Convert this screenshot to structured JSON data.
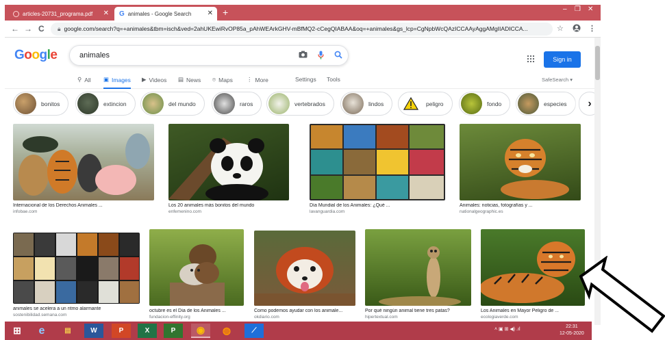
{
  "browser": {
    "tabs": [
      {
        "label": "articles-20731_programa.pdf"
      },
      {
        "label": "animales - Google Search"
      }
    ],
    "new_tab": "+",
    "tab_close": "✕",
    "window_controls": {
      "minimize": "–",
      "restore": "❐",
      "close": "✕"
    },
    "nav": {
      "back": "←",
      "forward": "→",
      "reload": "C"
    },
    "url": "google.com/search?q=+animales&tbm=isch&ved=2ahUKEwiRvOP85a_pAhWEArkGHV-mBfMQ2-cCegQIABAA&oq=+animales&gs_lcp=CgNpbWcQAzICCAAyAggAMgIIADICCA...",
    "bookmark_icon": "☆",
    "menu_icon": "⋮"
  },
  "google": {
    "logo": [
      "G",
      "o",
      "o",
      "g",
      "l",
      "e"
    ],
    "query": "animales",
    "sign_in": "Sign in",
    "tabs": [
      {
        "label": "All",
        "icon": "⚲"
      },
      {
        "label": "Images",
        "icon": "▣"
      },
      {
        "label": "Videos",
        "icon": "▶"
      },
      {
        "label": "News",
        "icon": "▤"
      },
      {
        "label": "Maps",
        "icon": "⌾"
      },
      {
        "label": "More",
        "icon": "⋮"
      },
      {
        "label": "Settings",
        "icon": ""
      },
      {
        "label": "Tools",
        "icon": ""
      }
    ],
    "safesearch": "SafeSearch ▾"
  },
  "chips": [
    {
      "label": "bonitos"
    },
    {
      "label": "extincion"
    },
    {
      "label": "del mundo"
    },
    {
      "label": "raros"
    },
    {
      "label": "vertebrados"
    },
    {
      "label": "lindos"
    },
    {
      "label": "peligro"
    },
    {
      "label": "fondo"
    },
    {
      "label": "especies"
    }
  ],
  "chip_next": "›",
  "results_row1": [
    {
      "title": "Internacional de los Derechos Animales ...",
      "source": "infobae.com"
    },
    {
      "title": "Los 20 animales más bonitos del mundo",
      "source": "enfemenino.com"
    },
    {
      "title": "Día Mundial de los Animales: ¿Qué ...",
      "source": "lavanguardia.com"
    },
    {
      "title": "Animales: noticias, fotografías y ...",
      "source": "nationalgeographic.es"
    }
  ],
  "results_row2": [
    {
      "title": "animales se acelera a un ritmo alarmante",
      "source": "sostenibilidad.semana.com"
    },
    {
      "title": "octubre es el Día de los Animales ...",
      "source": "fundacion-effinity.org"
    },
    {
      "title": "Como podemos ayudar con los animale...",
      "source": "okdiario.com"
    },
    {
      "title": "Por qué ningún animal tiene tres patas?",
      "source": "hipertextual.com"
    },
    {
      "title": "Los Animales en Mayor Peligro de ...",
      "source": "ecologiaverde.com"
    }
  ],
  "taskbar": {
    "start": "⊞",
    "apps": [
      "e",
      "▤",
      "W",
      "P",
      "X",
      "P",
      "◉",
      "◍",
      "⟋"
    ],
    "tray": "˄  ▣  ⊞  ◀)  .ıl",
    "time": "22:31",
    "date": "12-05-2020"
  }
}
